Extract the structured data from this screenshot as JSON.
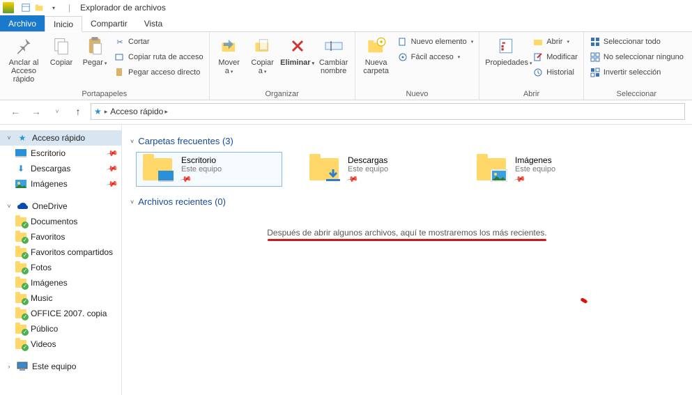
{
  "window": {
    "title": "Explorador de archivos"
  },
  "tabs": {
    "file": "Archivo",
    "home": "Inicio",
    "share": "Compartir",
    "view": "Vista"
  },
  "ribbon": {
    "clipboard": {
      "label": "Portapapeles",
      "pin": "Anclar al Acceso rápido",
      "copy": "Copiar",
      "paste": "Pegar",
      "cut": "Cortar",
      "copy_path": "Copiar ruta de acceso",
      "paste_shortcut": "Pegar acceso directo"
    },
    "organize": {
      "label": "Organizar",
      "move": "Mover a",
      "copyto": "Copiar a",
      "delete": "Eliminar",
      "rename": "Cambiar nombre"
    },
    "new": {
      "label": "Nuevo",
      "new_folder": "Nueva carpeta",
      "new_item": "Nuevo elemento",
      "easy_access": "Fácil acceso"
    },
    "open": {
      "label": "Abrir",
      "properties": "Propiedades",
      "open": "Abrir",
      "edit": "Modificar",
      "history": "Historial"
    },
    "select": {
      "label": "Seleccionar",
      "select_all": "Seleccionar todo",
      "select_none": "No seleccionar ninguno",
      "invert": "Invertir selección"
    }
  },
  "breadcrumb": {
    "root": "Acceso rápido"
  },
  "sidebar": {
    "quick_access": "Acceso rápido",
    "desktop": "Escritorio",
    "downloads": "Descargas",
    "pictures": "Imágenes",
    "onedrive": "OneDrive",
    "onedrive_items": [
      "Documentos",
      "Favoritos",
      "Favoritos compartidos",
      "Fotos",
      "Imágenes",
      "Music",
      "OFFICE 2007. copia",
      "Público",
      "Videos"
    ],
    "this_pc": "Este equipo"
  },
  "content": {
    "frequent_label": "Carpetas frecuentes (3)",
    "recent_label": "Archivos recientes (0)",
    "cards": [
      {
        "title": "Escritorio",
        "sub": "Este equipo"
      },
      {
        "title": "Descargas",
        "sub": "Este equipo"
      },
      {
        "title": "Imágenes",
        "sub": "Este equipo"
      }
    ],
    "empty_msg": "Después de abrir algunos archivos, aquí te mostraremos los más recientes."
  }
}
